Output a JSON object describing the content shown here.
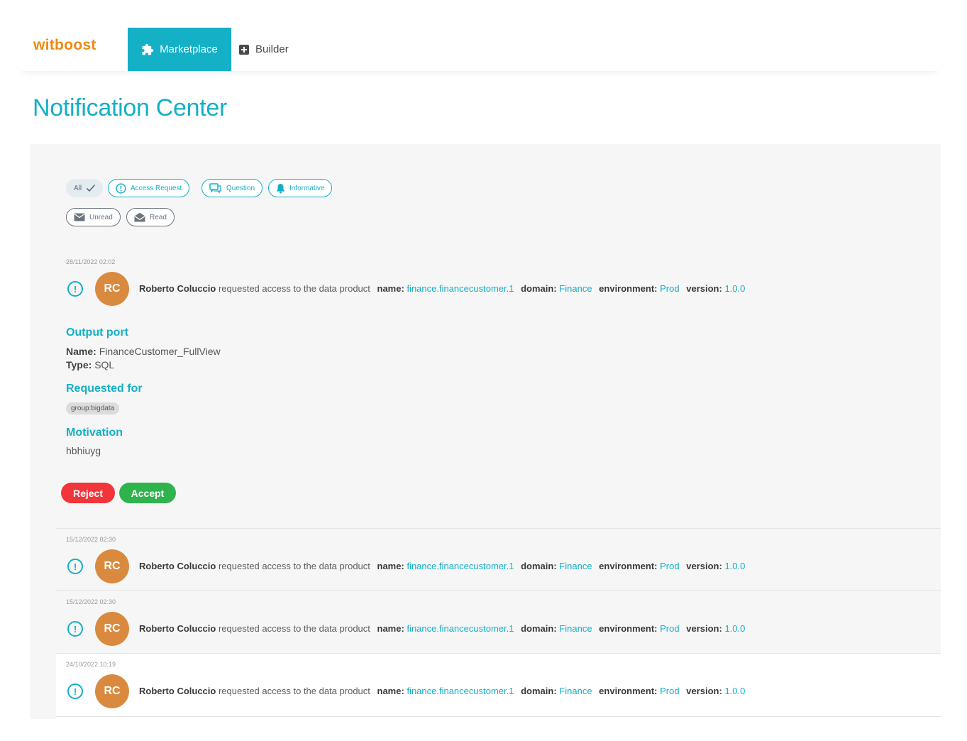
{
  "nav": {
    "logo": "witboost",
    "tabs": [
      {
        "label": "Marketplace",
        "icon": "puzzle-icon",
        "active": true
      },
      {
        "label": "Builder",
        "icon": "plus-square-icon",
        "active": false
      }
    ]
  },
  "page": {
    "title": "Notification Center"
  },
  "filters": {
    "all": "All",
    "types": [
      "Access Request",
      "Question",
      "Informative"
    ],
    "status": [
      "Unread",
      "Read"
    ]
  },
  "colors": {
    "accent": "#13b0c6",
    "logo": "#ec8a14",
    "avatar": "#d98a3e",
    "reject": "#f2353a",
    "accept": "#2fb34d"
  },
  "labels": {
    "name": "name:",
    "domain": "domain:",
    "environment": "environment:",
    "version": "version:",
    "requested_text": "requested access to the data product",
    "output_port": "Output port",
    "name_field": "Name:",
    "type_field": "Type:",
    "requested_for": "Requested for",
    "motivation": "Motivation",
    "reject": "Reject",
    "accept": "Accept"
  },
  "notifications": [
    {
      "date": "28/11/2022 02:02",
      "initials": "RC",
      "user": "Roberto Coluccio",
      "product_name": "finance.financecustomer.1",
      "domain": "Finance",
      "environment": "Prod",
      "version": "1.0.0",
      "expanded": true,
      "output_port_name": "FinanceCustomer_FullView",
      "output_port_type": "SQL",
      "requested_for": "group:bigdata",
      "motivation": "hbhiuyg"
    },
    {
      "date": "15/12/2022 02:30",
      "initials": "RC",
      "user": "Roberto Coluccio",
      "product_name": "finance.financecustomer.1",
      "domain": "Finance",
      "environment": "Prod",
      "version": "1.0.0"
    },
    {
      "date": "15/12/2022 02:30",
      "initials": "RC",
      "user": "Roberto Coluccio",
      "product_name": "finance.financecustomer.1",
      "domain": "Finance",
      "environment": "Prod",
      "version": "1.0.0"
    },
    {
      "date": "24/10/2022 10:19",
      "initials": "RC",
      "user": "Roberto Coluccio",
      "product_name": "finance.financecustomer.1",
      "domain": "Finance",
      "environment": "Prod",
      "version": "1.0.0"
    }
  ]
}
